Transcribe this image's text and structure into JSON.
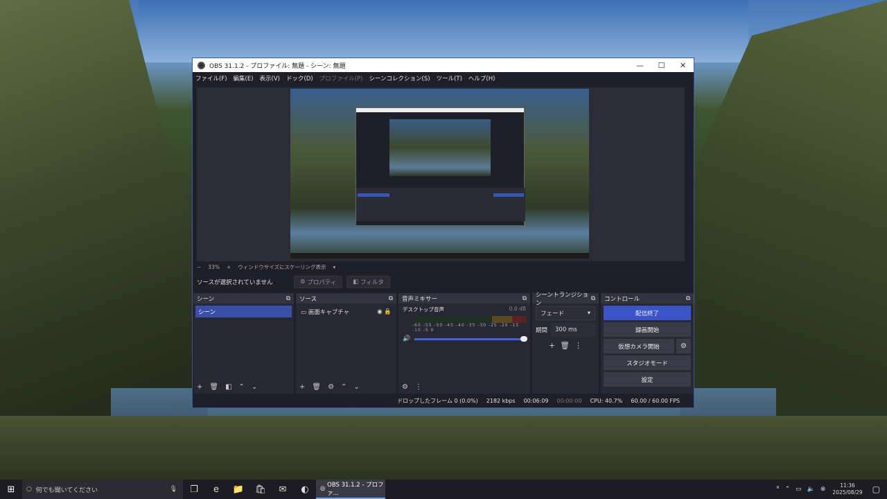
{
  "window": {
    "title": "OBS 31.1.2 - プロファイル: 無題 - シーン: 無題",
    "min": "—",
    "max": "☐",
    "close": "✕"
  },
  "menu": [
    "ファイル(F)",
    "編集(E)",
    "表示(V)",
    "ドック(D)",
    "プロファイル(P)",
    "シーンコレクション(S)",
    "ツール(T)",
    "ヘルプ(H)"
  ],
  "zoom": {
    "minus": "−",
    "value": "33%",
    "plus": "+",
    "mode": "ウィンドウサイズにスケーリング表示",
    "arrow": "▾"
  },
  "source_bar": {
    "no_source": "ソースが選択されていません",
    "properties": "プロパティ",
    "filters": "フィルタ"
  },
  "scenes": {
    "title": "シーン",
    "items": [
      "シーン"
    ]
  },
  "sources": {
    "title": "ソース",
    "items": [
      "画面キャプチャ"
    ]
  },
  "mixer": {
    "title": "音声ミキサー",
    "track": "デスクトップ音声",
    "db": "0.0 dB",
    "scale": "-60 -55 -50 -45 -40 -35 -30 -25 -20 -15 -10 -5 0",
    "volume": 1.0
  },
  "transitions": {
    "title": "シーントランジション",
    "selected": "フェード",
    "duration_label": "期間",
    "duration": "300 ms"
  },
  "controls": {
    "title": "コントロール",
    "stop_stream": "配信終了",
    "start_record": "録画開始",
    "start_vcam": "仮想カメラ開始",
    "studio_mode": "スタジオモード",
    "settings": "設定"
  },
  "status": {
    "dropped": "ドロップしたフレーム 0 (0.0%)",
    "bitrate": "2182 kbps",
    "stream_time": "00:06:09",
    "rec_time": "00:00:00",
    "cpu": "CPU: 40.7%",
    "fps": "60.00 / 60.00 FPS"
  },
  "taskbar": {
    "search_placeholder": "何でも聞いてください",
    "app_label": "OBS 31.1.2 - プロファ...",
    "time": "11:36",
    "date": "2025/08/29"
  },
  "colors": {
    "accent": "#3b55c6",
    "titlebar": "#ffffff",
    "dock_bg": "#272833"
  }
}
